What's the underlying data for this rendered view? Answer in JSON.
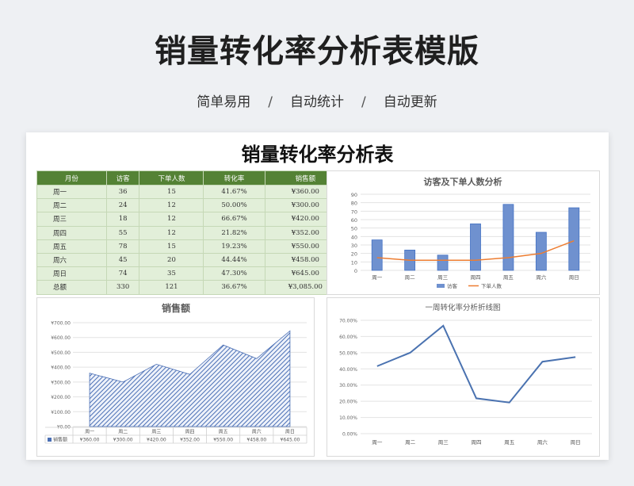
{
  "banner": {
    "title": "销量转化率分析表模版",
    "subtitle": [
      "简单易用",
      "自动统计",
      "自动更新"
    ],
    "separator": "/"
  },
  "sheet": {
    "title": "销量转化率分析表"
  },
  "table": {
    "headers": [
      "月份",
      "访客",
      "下单人数",
      "转化率",
      "销售额"
    ],
    "rows": [
      [
        "周一",
        "36",
        "15",
        "41.67%",
        "¥360.00"
      ],
      [
        "周二",
        "24",
        "12",
        "50.00%",
        "¥300.00"
      ],
      [
        "周三",
        "18",
        "12",
        "66.67%",
        "¥420.00"
      ],
      [
        "周四",
        "55",
        "12",
        "21.82%",
        "¥352.00"
      ],
      [
        "周五",
        "78",
        "15",
        "19.23%",
        "¥550.00"
      ],
      [
        "周六",
        "45",
        "20",
        "44.44%",
        "¥458.00"
      ],
      [
        "周日",
        "74",
        "35",
        "47.30%",
        "¥645.00"
      ],
      [
        "总额",
        "330",
        "121",
        "36.67%",
        "¥3,085.00"
      ]
    ]
  },
  "colors": {
    "header_green": "#548235",
    "row_green": "#e2efd9",
    "bar_blue": "#4472c4",
    "line_orange": "#ed7d31",
    "line_blue": "#4a72b0"
  },
  "chart_data": [
    {
      "type": "bar",
      "title": "访客及下单人数分析",
      "categories": [
        "周一",
        "周二",
        "周三",
        "周四",
        "周五",
        "周六",
        "周日"
      ],
      "series": [
        {
          "name": "访客",
          "type": "bar",
          "values": [
            36,
            24,
            18,
            55,
            78,
            45,
            74
          ]
        },
        {
          "name": "下单人数",
          "type": "line",
          "values": [
            15,
            12,
            12,
            12,
            15,
            20,
            35
          ]
        }
      ],
      "ylim": [
        0,
        90
      ],
      "yticks": [
        0,
        10,
        20,
        30,
        40,
        50,
        60,
        70,
        80,
        90
      ],
      "legend": "bottom",
      "grid": true
    },
    {
      "type": "area",
      "title": "销售额",
      "categories": [
        "周一",
        "周二",
        "周三",
        "周四",
        "周五",
        "周六",
        "周日"
      ],
      "series": [
        {
          "name": "销售额",
          "values": [
            360,
            300,
            420,
            352,
            550,
            458,
            645
          ]
        }
      ],
      "value_labels": [
        "¥360.00",
        "¥300.00",
        "¥420.00",
        "¥352.00",
        "¥550.00",
        "¥458.00",
        "¥645.00"
      ],
      "ylim": [
        0,
        700
      ],
      "yticks": [
        "¥0.00",
        "¥100.00",
        "¥200.00",
        "¥300.00",
        "¥400.00",
        "¥500.00",
        "¥600.00",
        "¥700.00"
      ],
      "legend": "data-table",
      "grid": true
    },
    {
      "type": "line",
      "title": "一周转化率分析折线图",
      "categories": [
        "周一",
        "周二",
        "周三",
        "周四",
        "周五",
        "周六",
        "周日"
      ],
      "series": [
        {
          "values": [
            41.67,
            50.0,
            66.67,
            21.82,
            19.23,
            44.44,
            47.3
          ]
        }
      ],
      "ylim": [
        0,
        70
      ],
      "yticks": [
        "0.00%",
        "10.00%",
        "20.00%",
        "30.00%",
        "40.00%",
        "50.00%",
        "60.00%",
        "70.00%"
      ],
      "grid": true
    }
  ]
}
